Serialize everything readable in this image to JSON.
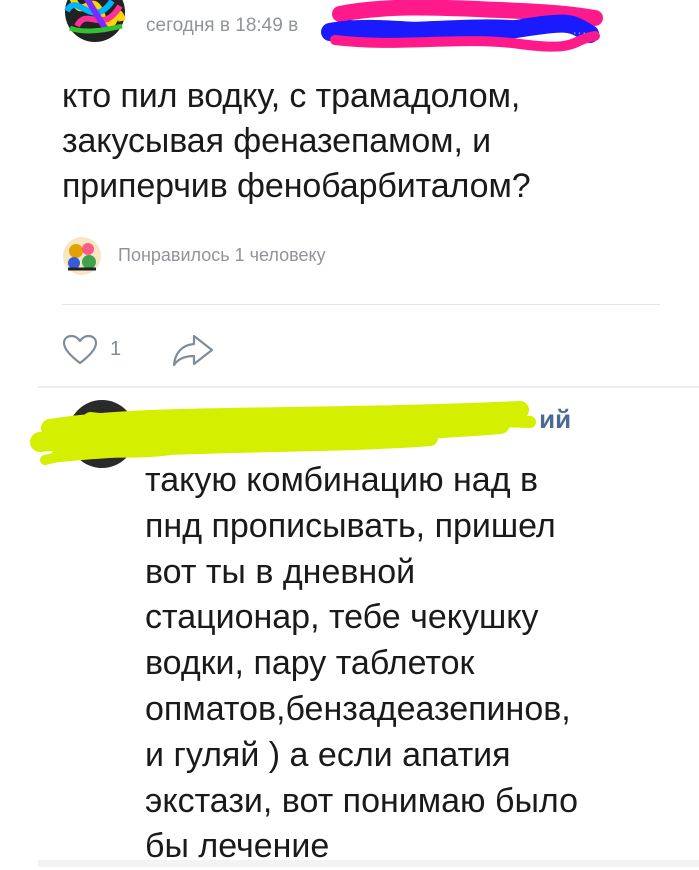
{
  "post": {
    "date": "сегодня в 18:49 в",
    "date_tail": "…",
    "text": "кто пил водку, с трамадолом,\nзакусывая феназепамом, и\nприперчив фенобарбиталом?",
    "likes_text": "Понравилось 1 человеку",
    "like_count": "1"
  },
  "comment": {
    "author_visible": "ий",
    "text": "такую комбинацию над в\nпнд прописывать, пришел\nвот ты в дневной\nстационар, тебе чекушку\nводки, пару таблеток\nопматов,бензадеазепинов,\nи гуляй ) а если апатия\nэкстази, вот понимаю было\nбы лечение"
  },
  "icons": {
    "like": "heart-outline-icon",
    "share": "share-arrow-icon"
  },
  "colors": {
    "secondary_text": "#909499",
    "author": "#4a6b94",
    "icon": "#818c99",
    "redaction_pink": "#ff1a8c",
    "redaction_blue": "#1a1aff",
    "redaction_yellow": "#d4f000"
  }
}
